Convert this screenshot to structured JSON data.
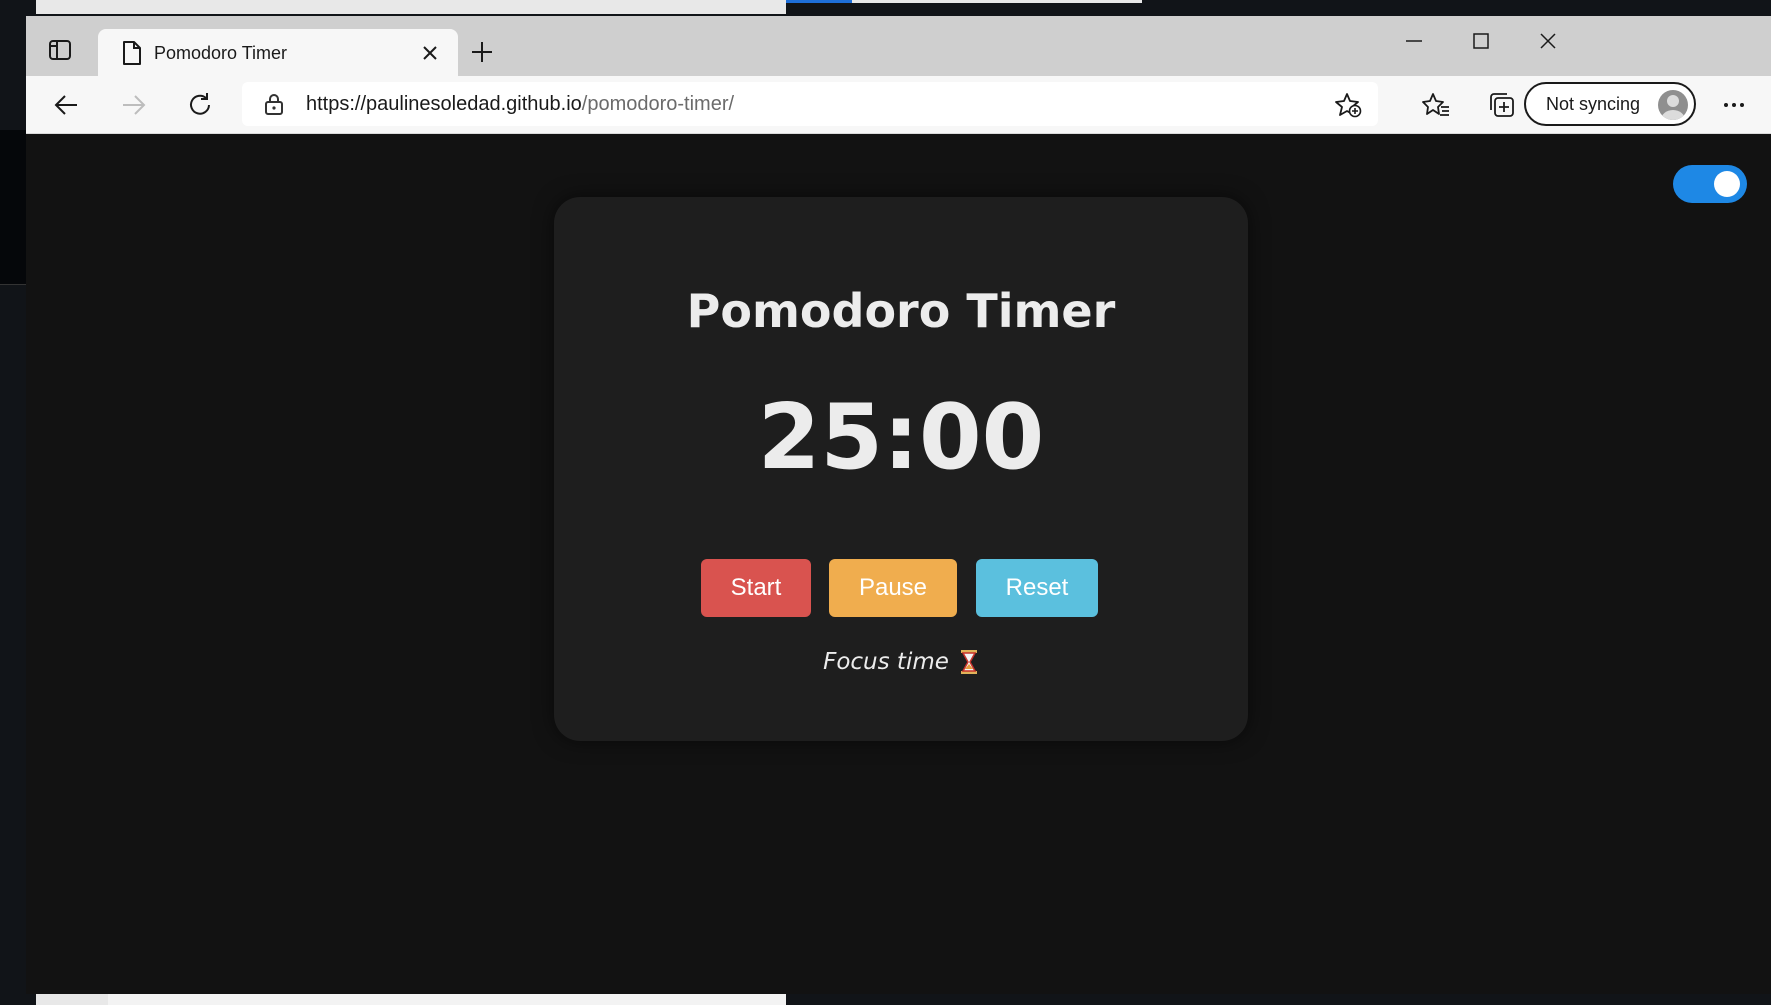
{
  "browser": {
    "tab": {
      "title": "Pomodoro Timer"
    },
    "address": {
      "host": "https://paulinesoledad.github.io",
      "path": "/pomodoro-timer/"
    },
    "sync": {
      "label": "Not syncing"
    }
  },
  "page": {
    "title": "Pomodoro Timer",
    "timer": "25:00",
    "buttons": {
      "start": "Start",
      "pause": "Pause",
      "reset": "Reset"
    },
    "status": "Focus time",
    "theme_toggle": {
      "on": true,
      "color": "#1e88e5"
    },
    "colors": {
      "start": "#d9534f",
      "pause": "#f0ad4e",
      "reset": "#5bc0de",
      "background": "#121212",
      "card": "#1e1e1e"
    }
  }
}
